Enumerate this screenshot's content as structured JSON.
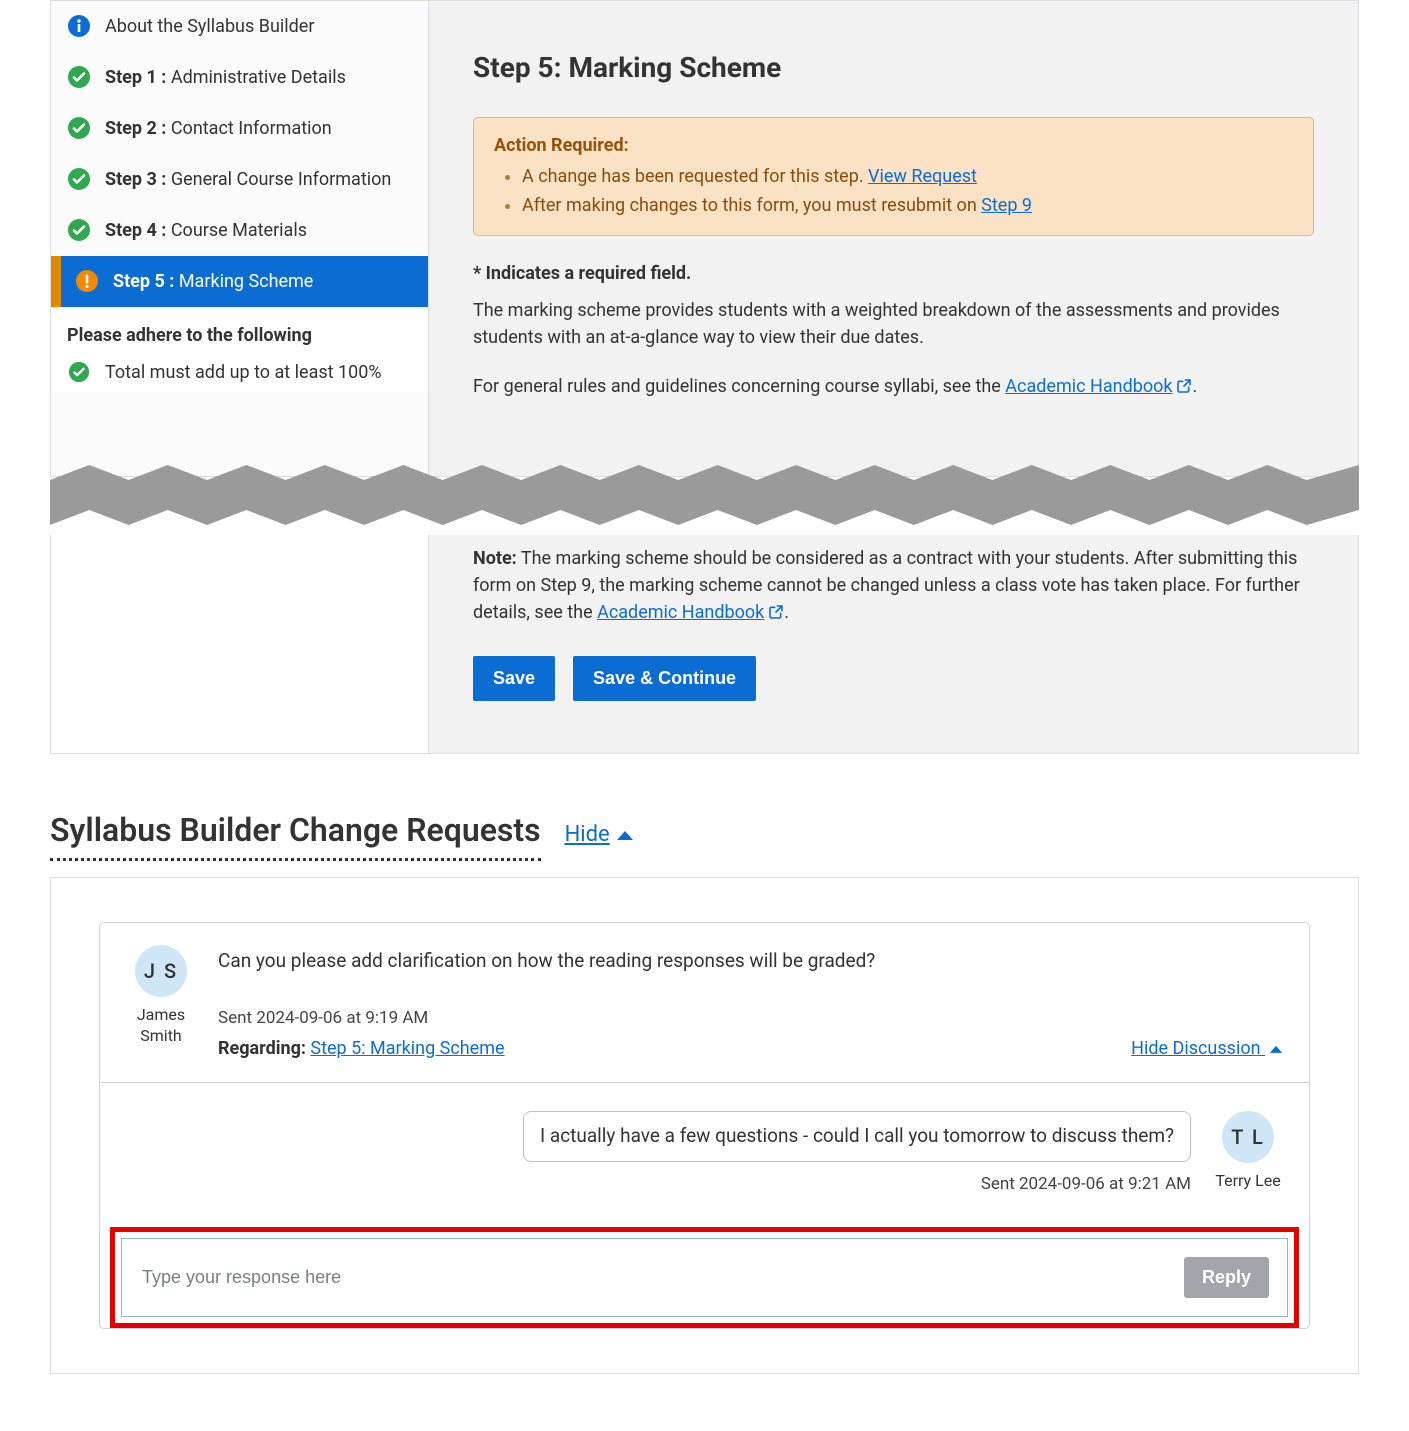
{
  "sidebar": {
    "items": [
      {
        "icon": "info",
        "bold": "",
        "rest": "About the Syllabus Builder"
      },
      {
        "icon": "check",
        "bold": "Step 1 :",
        "rest": " Administrative Details"
      },
      {
        "icon": "check",
        "bold": "Step 2 :",
        "rest": " Contact Information"
      },
      {
        "icon": "check",
        "bold": "Step 3 :",
        "rest": " General Course Information"
      },
      {
        "icon": "check",
        "bold": "Step 4 :",
        "rest": " Course Materials"
      },
      {
        "icon": "warn",
        "bold": "Step 5 :",
        "rest": " Marking Scheme",
        "active": true
      }
    ],
    "note_heading": "Please adhere to the following",
    "rules": [
      "Total must add up to at least 100%"
    ]
  },
  "content": {
    "heading": "Step 5: Marking Scheme",
    "alert": {
      "title": "Action Required:",
      "items": [
        {
          "text": "A change has been requested for this step. ",
          "link_text": "View Request"
        },
        {
          "text": "After making changes to this form, you must resubmit on ",
          "link_text": "Step 9"
        }
      ]
    },
    "required_note": "* Indicates a required field.",
    "p1": "The marking scheme provides students with a weighted breakdown of the assessments and provides students with an at-a-glance way to view their due dates.",
    "p2_pre": "For general rules and guidelines concerning course syllabi, see the ",
    "p2_link": "Academic Handbook",
    "p2_post": ".",
    "note_label": "Note:",
    "note_text": " The marking scheme should be considered as a contract with your students. After submitting this form on Step 9, the marking scheme cannot be changed unless a class vote has taken place. For further details, see the ",
    "note_link": "Academic Handbook",
    "note_post": ".",
    "btn_save": "Save",
    "btn_save_continue": "Save & Continue"
  },
  "cr": {
    "title": "Syllabus Builder Change Requests",
    "toggle": "Hide",
    "request": {
      "avatar_initials": "J S",
      "avatar_name": "James Smith",
      "message": "Can you please add clarification on how the reading responses will be graded?",
      "sent": "Sent 2024-09-06 at 9:19 AM",
      "regarding_label": "Regarding:",
      "regarding_link": "Step 5: Marking Scheme",
      "hide_discussion": "Hide Discussion",
      "reply": {
        "avatar_initials": "T L",
        "avatar_name": "Terry Lee",
        "bubble": "I actually have a few questions - could I call you tomorrow to discuss them?",
        "sent": "Sent 2024-09-06 at 9:21 AM"
      },
      "reply_placeholder": "Type your response here",
      "reply_button": "Reply"
    }
  }
}
